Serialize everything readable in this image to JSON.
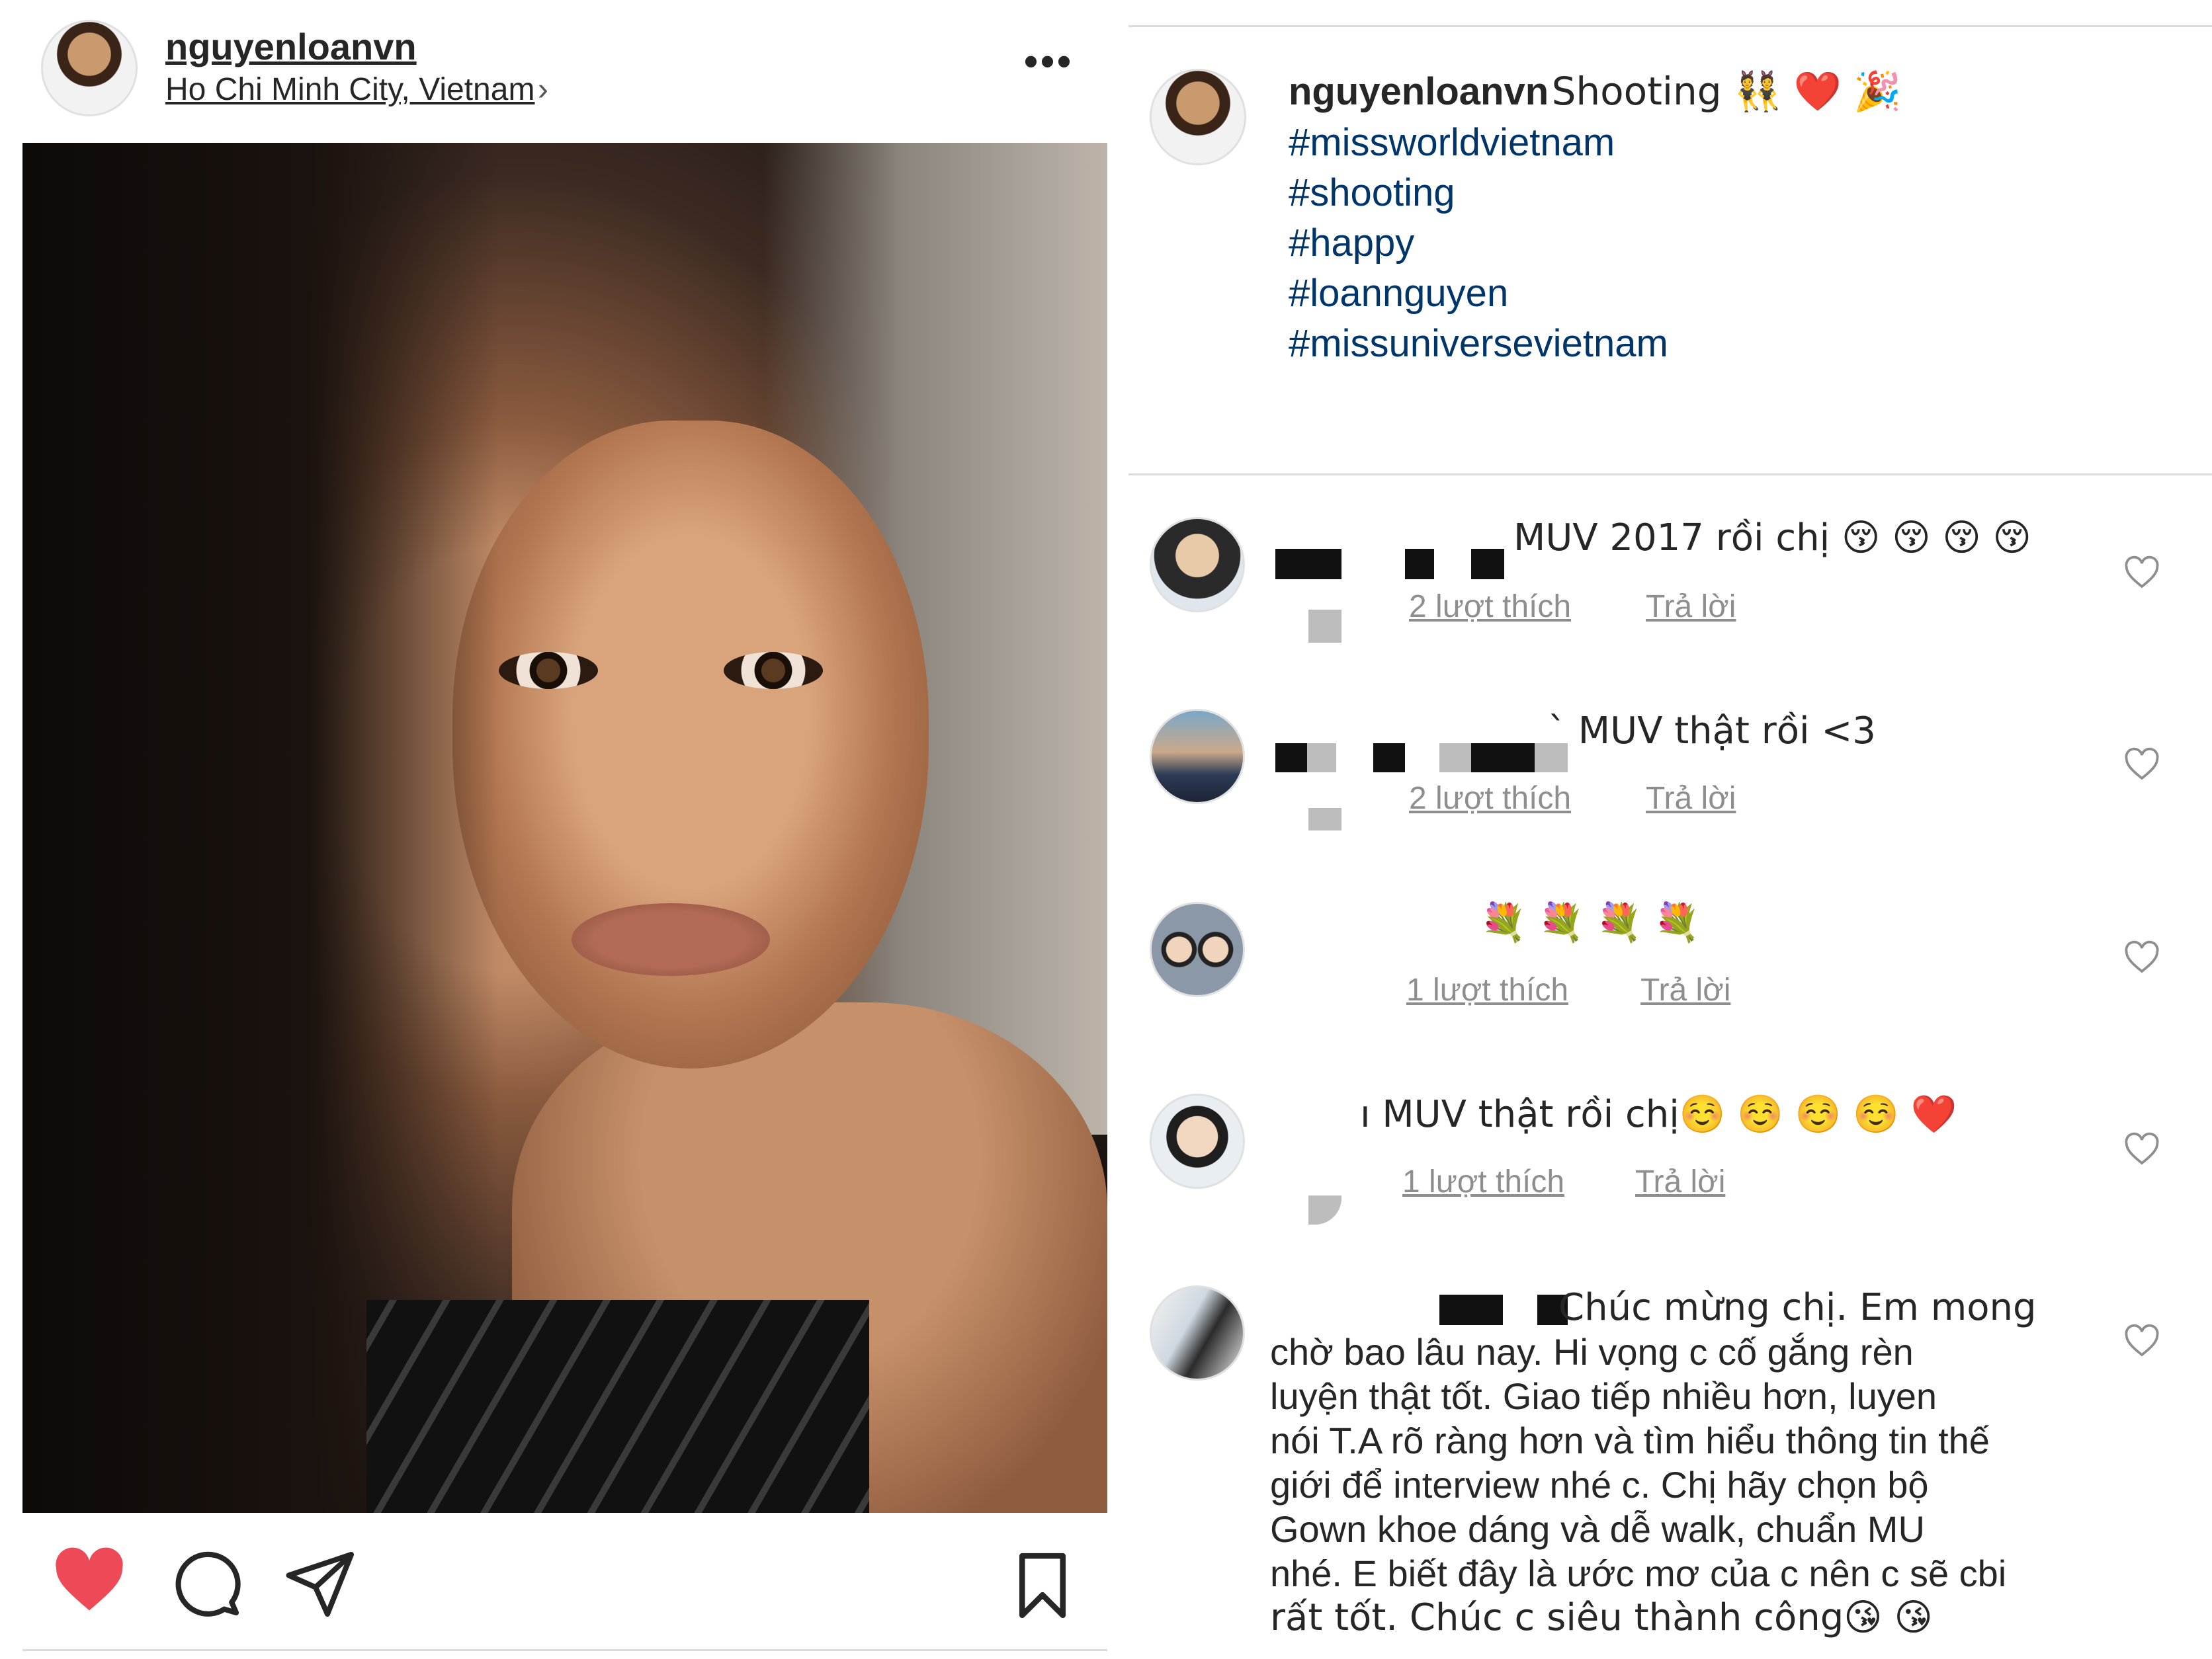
{
  "post": {
    "username": "nguyenloanvn",
    "location": "Ho Chi Minh City, Vietnam",
    "more_label": "•••"
  },
  "caption": {
    "username": "nguyenloanvn",
    "text": "Shooting 👯 ❤️ 🎉",
    "hashtags": [
      "#missworldvietnam",
      "#shooting",
      "#happy",
      "#loannguyen",
      "#missuniversevietnam"
    ]
  },
  "comments": [
    {
      "text": "MUV 2017 rồi chị 😚 😚 😚 😚",
      "likes": "2 lượt thích",
      "reply": "Trả lời"
    },
    {
      "text": "` MUV thật rồi <3",
      "likes": "2 lượt thích",
      "reply": "Trả lời"
    },
    {
      "text": "💐 💐 💐 💐",
      "likes": "1 lượt thích",
      "reply": "Trả lời"
    },
    {
      "text": "ı MUV thật rồi chị☺️ ☺️ ☺️ ☺️ ❤️",
      "likes": "1 lượt thích",
      "reply": "Trả lời"
    },
    {
      "text_lines": [
        "Chúc mừng chị. Em mong",
        "chờ bao lâu nay. Hi vọng c cố gắng rèn",
        "luyện thật tốt. Giao tiếp nhiều hơn, luyen",
        "nói T.A rõ ràng hơn và tìm hiểu thông tin thế",
        "giới để interview nhé c. Chị hãy chọn bộ",
        "Gown khoe dáng và dễ walk, chuẩn MU",
        "nhé. E biết đây là ước mơ của c nên c sẽ cbi",
        "rất tốt. Chúc c siêu thành công😘 😘"
      ]
    }
  ],
  "colors": {
    "liked_heart": "#ed4956",
    "hashtag": "#003569",
    "meta": "#8e8e8e"
  },
  "icons": [
    "heart-filled-icon",
    "comment-icon",
    "share-icon",
    "bookmark-icon",
    "heart-outline-icon",
    "chevron-right-icon"
  ]
}
